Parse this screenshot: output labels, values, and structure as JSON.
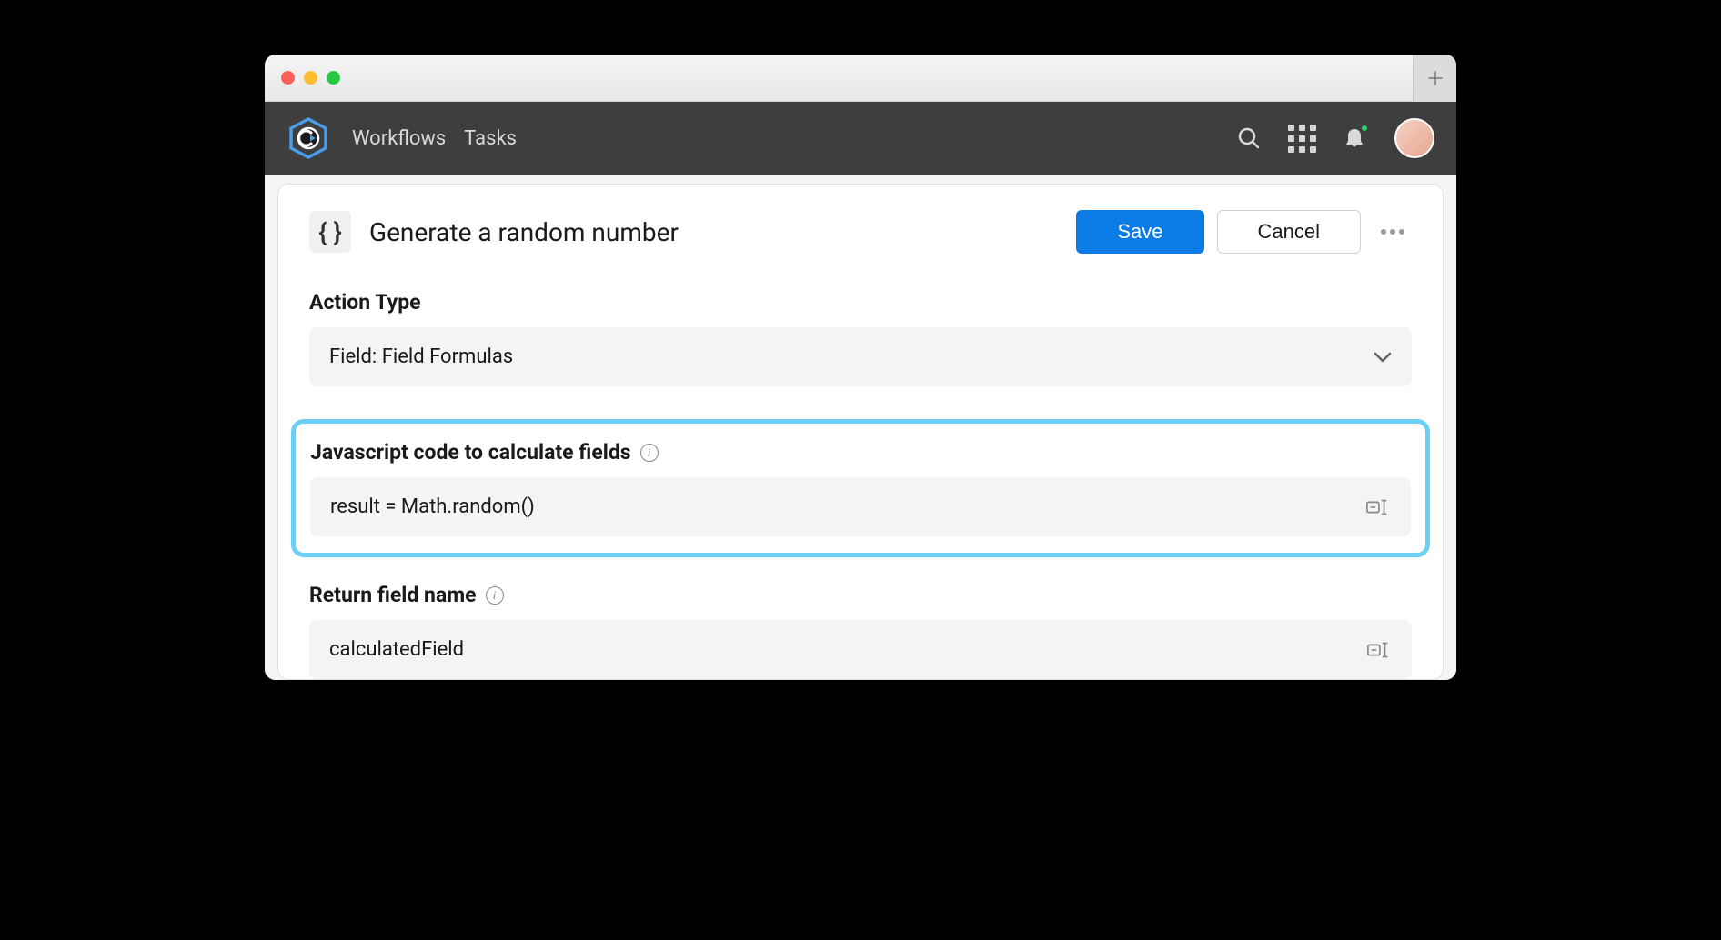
{
  "nav": {
    "workflows": "Workflows",
    "tasks": "Tasks"
  },
  "card": {
    "icon": "{ }",
    "title": "Generate a random number",
    "save_label": "Save",
    "cancel_label": "Cancel"
  },
  "sections": {
    "action_type": {
      "label": "Action Type",
      "value": "Field: Field Formulas"
    },
    "js_code": {
      "label": "Javascript code to calculate fields",
      "value": "result = Math.random()"
    },
    "return_field": {
      "label": "Return field name",
      "value": "calculatedField"
    }
  }
}
